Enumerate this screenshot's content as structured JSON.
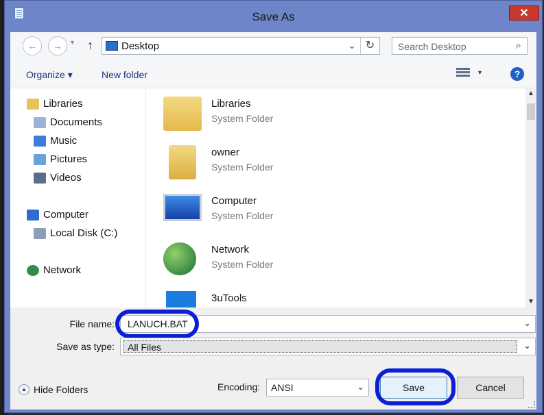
{
  "window": {
    "title": "Save As",
    "close_glyph": "✕",
    "title_icon": "notepad-icon"
  },
  "nav": {
    "back_glyph": "←",
    "forward_glyph": "→",
    "history_glyph": "▾",
    "up_glyph": "↑",
    "address": "Desktop",
    "address_chevron": "⌄",
    "refresh_glyph": "↻",
    "search_placeholder": "Search Desktop",
    "search_glyph": "⌕"
  },
  "toolbar": {
    "organize": "Organize ▾",
    "new_folder": "New folder",
    "view_drop": "▾",
    "help": "?"
  },
  "tree": [
    {
      "label": "Libraries",
      "icon": "libraries-icon",
      "color": "#e8c15a"
    },
    {
      "label": "Documents",
      "icon": "documents-icon",
      "color": "#9bb3d9"
    },
    {
      "label": "Music",
      "icon": "music-icon",
      "color": "#3b7dd8"
    },
    {
      "label": "Pictures",
      "icon": "pictures-icon",
      "color": "#6aa3d9"
    },
    {
      "label": "Videos",
      "icon": "videos-icon",
      "color": "#5a6e8c"
    },
    {
      "label": "Computer",
      "icon": "computer-icon",
      "color": "#2d6cd1"
    },
    {
      "label": "Local Disk (C:)",
      "icon": "disk-icon",
      "color": "#8aa0b8"
    },
    {
      "label": "Network",
      "icon": "network-icon",
      "color": "#2f8f4a"
    }
  ],
  "files": [
    {
      "name": "Libraries",
      "type": "System Folder",
      "icon": "libraries-folder-icon"
    },
    {
      "name": "owner",
      "type": "System Folder",
      "icon": "user-folder-icon"
    },
    {
      "name": "Computer",
      "type": "System Folder",
      "icon": "computer-icon"
    },
    {
      "name": "Network",
      "type": "System Folder",
      "icon": "network-globe-icon"
    },
    {
      "name": "3uTools",
      "type": "",
      "icon": "3utools-icon"
    }
  ],
  "scroll": {
    "up": "▲",
    "down": "▼"
  },
  "form": {
    "file_name_label": "File name:",
    "file_name_value": "LANUCH.BAT",
    "save_type_label": "Save as type:",
    "save_type_value": "All Files",
    "dropdown_glyph": "⌄",
    "hide_folders": "Hide Folders",
    "hide_glyph": "▲",
    "encoding_label": "Encoding:",
    "encoding_value": "ANSI",
    "save_label": "Save",
    "cancel_label": "Cancel"
  },
  "colors": {
    "annotation": "#0a1fd6",
    "chrome": "#6e86c9",
    "close": "#c7392c",
    "link": "#1e3287"
  }
}
